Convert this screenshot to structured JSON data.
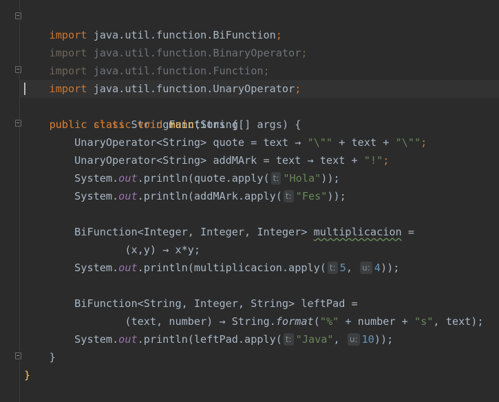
{
  "imports": [
    {
      "keyword": "import",
      "path": "java.util.function.BiFunction",
      "semi": ";"
    },
    {
      "keyword": "import",
      "path": "java.util.function.BinaryOperator",
      "semi": ";"
    },
    {
      "keyword": "import",
      "path": "java.util.function.Function",
      "semi": ";"
    },
    {
      "keyword": "import",
      "path": "java.util.function.UnaryOperator",
      "semi": ";"
    }
  ],
  "class_decl": {
    "public": "public",
    "class": "class",
    "name": "StringFunctions",
    "brace": " {"
  },
  "main_decl": {
    "public": "public",
    "static": "static",
    "void": "void",
    "name": "main",
    "params": "(String[] args) {"
  },
  "l8": {
    "type": "UnaryOperator<String> quote = text ",
    "arrow": "→",
    "s1": "\"\\\"\"",
    "plus1": " + text + ",
    "s2": "\"\\\"\"",
    "semi": ";"
  },
  "l9": {
    "type": "UnaryOperator<String> addMArk = text ",
    "arrow": "→",
    "mid": " text + ",
    "s1": "\"!\"",
    "semi": ";"
  },
  "l10": {
    "sys": "System.",
    "out": "out",
    "call": ".println(quote.apply(",
    "hint": "t:",
    "arg": "\"Hola\"",
    "end": "));"
  },
  "l11": {
    "sys": "System.",
    "out": "out",
    "call": ".println(addMArk.apply(",
    "hint": "t:",
    "arg": "\"Fes\"",
    "end": "));"
  },
  "l13": {
    "type": "BiFunction<Integer, Integer, Integer> ",
    "name": "multiplicacion",
    "eq": " ="
  },
  "l14": {
    "text": "(x,y) ",
    "arrow": "→",
    "body": " x*y;"
  },
  "l15": {
    "sys": "System.",
    "out": "out",
    "call": ".println(multiplicacion.apply(",
    "hint1": "t:",
    "arg1": "5",
    "comma": ", ",
    "hint2": "u:",
    "arg2": "4",
    "end": "));"
  },
  "l17": {
    "text": "BiFunction<String, Integer, String> leftPad ="
  },
  "l18": {
    "pre": "(text, number) ",
    "arrow": "→",
    "mid": " String.",
    "fmt": "format",
    "open": "(",
    "s1": "\"%\"",
    "plus": " + number + ",
    "s2": "\"s\"",
    "end": ", text);"
  },
  "l19": {
    "sys": "System.",
    "out": "out",
    "call": ".println(leftPad.apply(",
    "hint1": "t:",
    "arg1": "\"Java\"",
    "comma": ", ",
    "hint2": "u:",
    "arg2": "10",
    "end": "));"
  },
  "close_main": "}",
  "close_class": "}"
}
